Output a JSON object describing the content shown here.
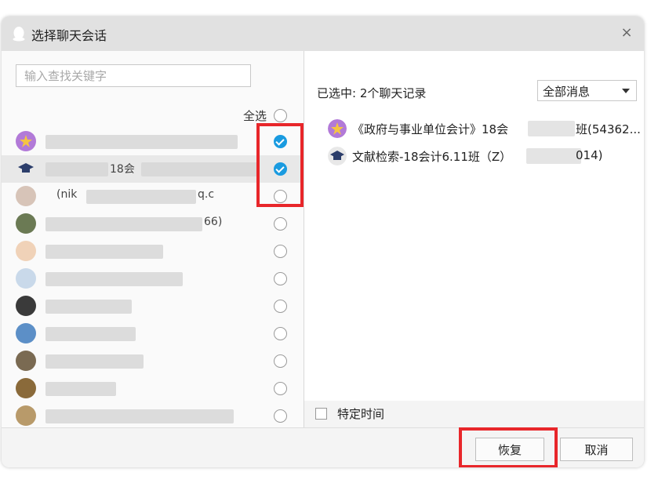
{
  "dialog": {
    "title": "选择聊天会话",
    "close_icon": "×"
  },
  "left": {
    "search_placeholder": "输入查找关键字",
    "select_all_label": "全选",
    "contacts": [
      {
        "text_a": "",
        "checked": true
      },
      {
        "text_a": "",
        "text_b": "18会",
        "checked": true
      },
      {
        "text_a": "(nik",
        "text_b": "q.c",
        "checked": false
      },
      {
        "text_a": "",
        "text_b": "66)",
        "checked": false
      },
      {
        "text_a": "",
        "checked": false
      },
      {
        "text_a": "",
        "checked": false
      },
      {
        "text_a": "",
        "checked": false
      },
      {
        "text_a": "",
        "checked": false
      },
      {
        "text_a": "",
        "checked": false
      },
      {
        "text_a": "",
        "checked": false
      },
      {
        "text_a": "",
        "checked": false
      }
    ]
  },
  "right": {
    "status": "已选中: 2个聊天记录",
    "filter_value": "全部消息",
    "selected": [
      {
        "text_a": "《政府与事业单位会计》18会",
        "text_b": "班(54362..."
      },
      {
        "text_a": "文献检索-18会计6.11班（Z）",
        "text_b": "014)"
      }
    ],
    "specific_time_label": "特定时间"
  },
  "footer": {
    "restore_label": "恢复",
    "cancel_label": "取消"
  },
  "colors": {
    "accent": "#1a9be0",
    "highlight": "#e8262a"
  }
}
